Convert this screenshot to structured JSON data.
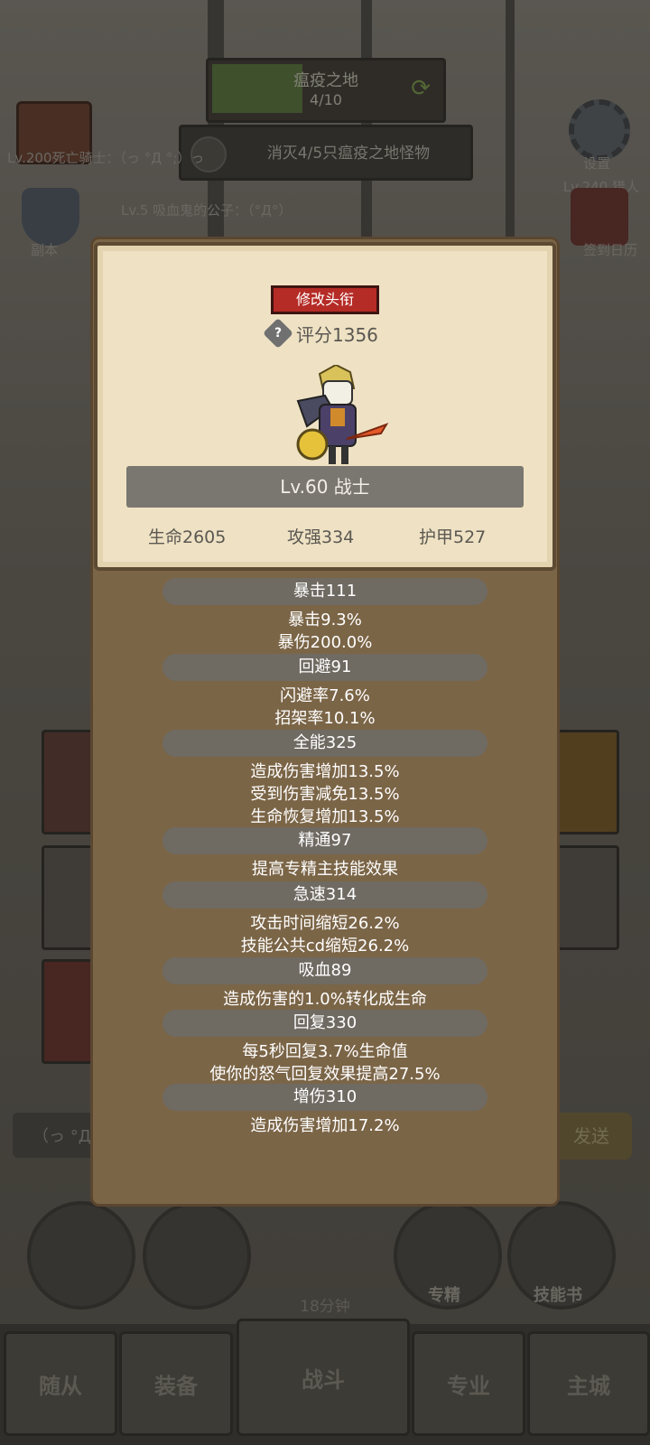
{
  "background": {
    "zone_title": "瘟疫之地",
    "zone_progress": "4/10",
    "quest_text": "消灭4/5只瘟疫之地怪物",
    "left_chat_line": "Lv.200死亡骑士：（っ °Д °;）っ",
    "left_chat_line2": "Lv.5 吸血鬼的公子：（°Д°）",
    "left_menu_label": "副本",
    "right_top_label": "设置",
    "right_top_sub": "Lv.240 猎人",
    "right_menu_label": "签到日历",
    "chat_placeholder": "（っ °Д °",
    "send_label": "发送",
    "skill_labels": [
      "专精",
      "技能书"
    ],
    "chest_timer": "18分钟",
    "nav": [
      "随从",
      "装备",
      "战斗",
      "专业",
      "主城"
    ]
  },
  "panel": {
    "edit_title_label": "修改头衔",
    "score_label": "评分1356",
    "help_icon_glyph": "?",
    "level_label": "Lv.60 战士",
    "stats": {
      "hp": "生命2605",
      "ap": "攻强334",
      "armor": "护甲527"
    },
    "attributes": [
      {
        "head": "暴击111",
        "lines": [
          "暴击9.3%",
          "暴伤200.0%"
        ]
      },
      {
        "head": "回避91",
        "lines": [
          "闪避率7.6%",
          "招架率10.1%"
        ]
      },
      {
        "head": "全能325",
        "lines": [
          "造成伤害增加13.5%",
          "受到伤害减免13.5%",
          "生命恢复增加13.5%"
        ]
      },
      {
        "head": "精通97",
        "lines": [
          "提高专精主技能效果"
        ]
      },
      {
        "head": "急速314",
        "lines": [
          "攻击时间缩短26.2%",
          "技能公共cd缩短26.2%"
        ]
      },
      {
        "head": "吸血89",
        "lines": [
          "造成伤害的1.0%转化成生命"
        ]
      },
      {
        "head": "回复330",
        "lines": [
          "每5秒回复3.7%生命值",
          "使你的怒气回复效果提高27.5%"
        ]
      },
      {
        "head": "增伤310",
        "lines": [
          "造成伤害增加17.2%"
        ]
      }
    ]
  }
}
